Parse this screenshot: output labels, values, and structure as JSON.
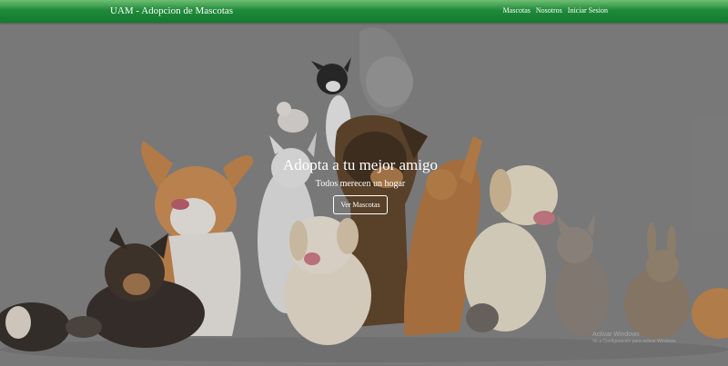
{
  "navbar": {
    "brand": "UAM - Adopcion de Mascotas",
    "links": [
      {
        "label": "Mascotas"
      },
      {
        "label": "Nosotros"
      },
      {
        "label": "Iniciar Sesion"
      }
    ]
  },
  "hero": {
    "title": "Adopta a tu mejor amigo",
    "subtitle": "Todos merecen un hogar",
    "button_label": "Ver Mascotas"
  },
  "watermark": {
    "line1": "Activar Windows",
    "line2": "Ve a Configuración para activar Windows."
  },
  "colors": {
    "navbar_top": "#6fbf73",
    "navbar_bottom": "#137a2f",
    "hero_background": "#828282"
  }
}
